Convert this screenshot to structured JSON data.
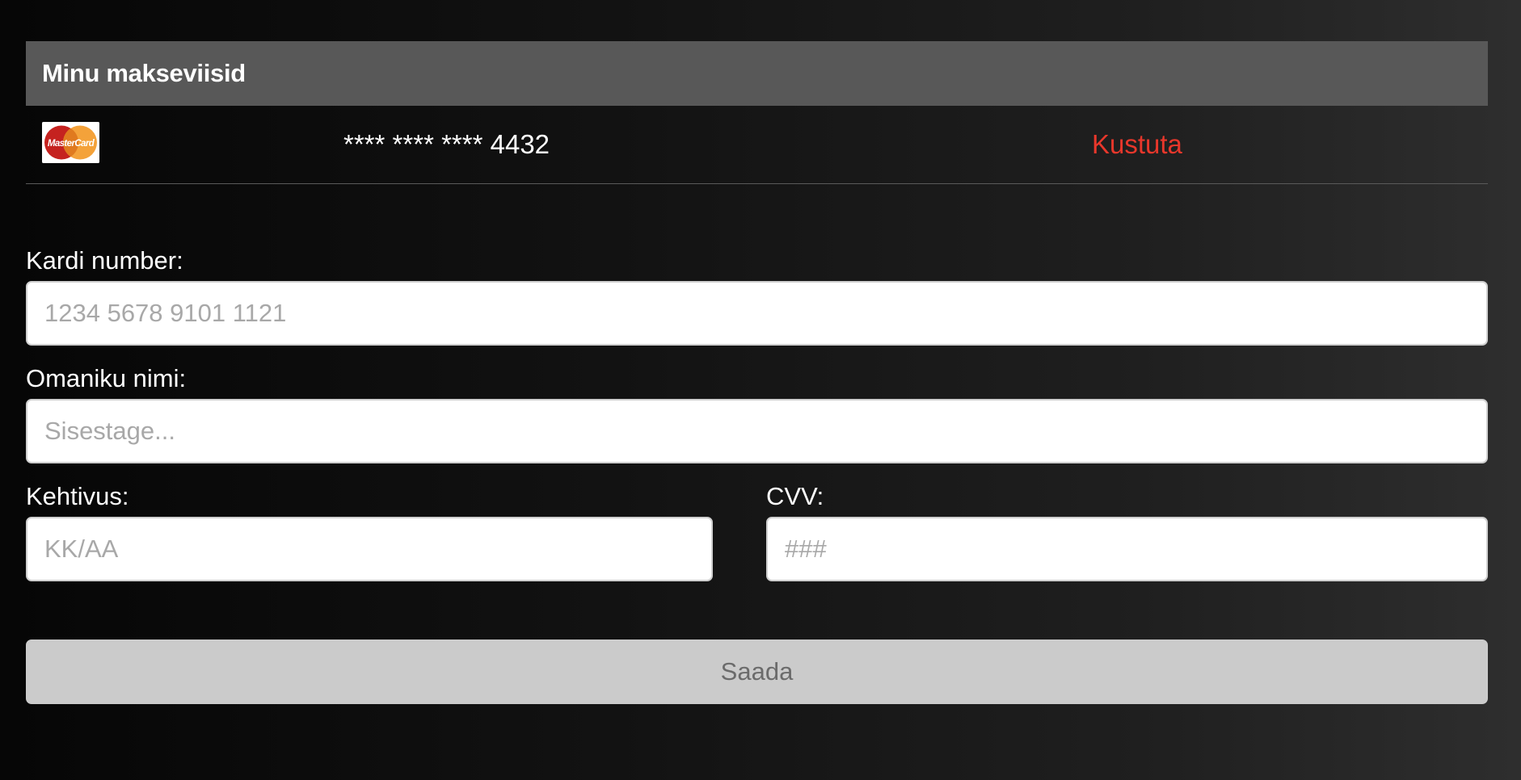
{
  "payment_methods": {
    "title": "Minu makseviisid",
    "cards": [
      {
        "brand": "MasterCard",
        "masked_number": "**** **** **** 4432",
        "delete_label": "Kustuta"
      }
    ]
  },
  "form": {
    "card_number": {
      "label": "Kardi number:",
      "placeholder": "1234 5678 9101 1121",
      "value": ""
    },
    "owner_name": {
      "label": "Omaniku nimi:",
      "placeholder": "Sisestage...",
      "value": ""
    },
    "expiry": {
      "label": "Kehtivus:",
      "placeholder": "KK/AA",
      "value": ""
    },
    "cvv": {
      "label": "CVV:",
      "placeholder": "###",
      "value": ""
    },
    "submit_label": "Saada"
  },
  "icons": {
    "card_brand": "mastercard-logo-icon"
  },
  "colors": {
    "header_bg": "#585858",
    "delete_text": "#e8372b",
    "button_bg": "#cbcbcb",
    "button_text": "#6b6b6b"
  }
}
